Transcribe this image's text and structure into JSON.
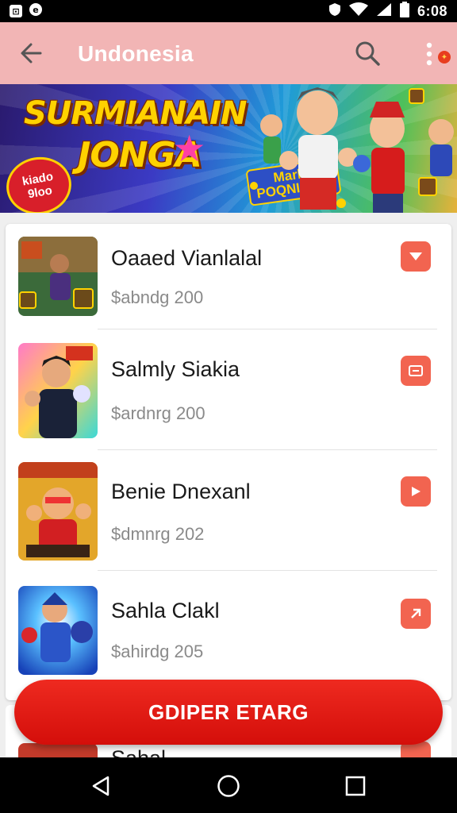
{
  "status_bar": {
    "time": "6:08",
    "left_icons": [
      "sim-card-icon",
      "notification-icon"
    ],
    "right_icons": [
      "shield-icon",
      "wifi-icon",
      "signal-icon",
      "battery-icon"
    ]
  },
  "app_bar": {
    "title": "Undonesia",
    "back_icon": "arrow-left-icon",
    "search_icon": "search-icon",
    "more_icon": "more-vertical-icon",
    "badge_icon": "notification-dot-icon",
    "background": "#f2b5b5"
  },
  "banner": {
    "title_line1": "SURMIANAIN",
    "title_line2": "JONGA",
    "badge_text_1": "kiado",
    "badge_text_2": "9loo",
    "promo_line1": "Markil",
    "promo_line2": "POQNIORSI"
  },
  "games": [
    {
      "name": "Oaaed Vianlalal",
      "price": "$abndg 200",
      "action_icon": "chevron-down-icon"
    },
    {
      "name": "Salmly Siakia",
      "price": "$ardnrg 200",
      "action_icon": "wallet-icon"
    },
    {
      "name": "Benie Dnexanl",
      "price": "$dmnrg 202",
      "action_icon": "play-icon"
    },
    {
      "name": "Sahla Clakl",
      "price": "$ahirdg 205",
      "action_icon": "arrow-up-right-icon"
    }
  ],
  "partial_item": {
    "name": "Sahal"
  },
  "cta": {
    "label": "GDIPER ETARG",
    "color": "#e3140e"
  },
  "nav_bar": {
    "icons": [
      "back-triangle-icon",
      "home-circle-icon",
      "recents-square-icon"
    ]
  },
  "colors": {
    "accent": "#f26450",
    "primary_red": "#e3140e"
  }
}
